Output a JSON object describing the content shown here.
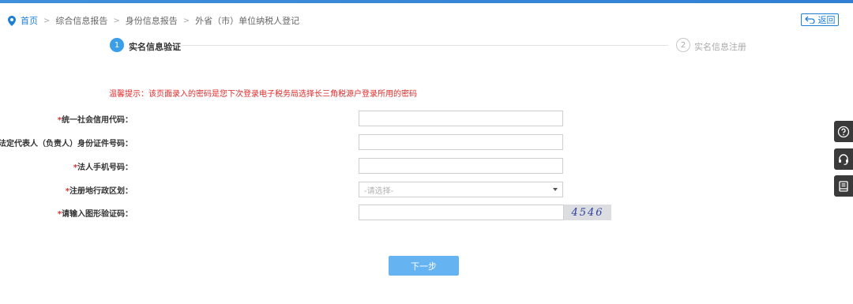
{
  "breadcrumb": {
    "items": [
      "首页",
      "综合信息报告",
      "身份信息报告",
      "外省（市）单位纳税人登记"
    ],
    "separator": ">"
  },
  "back_button": {
    "label": "返回",
    "icon": "back-arrow-icon"
  },
  "steps": [
    {
      "number": "1",
      "label": "实名信息验证",
      "state": "active"
    },
    {
      "number": "2",
      "label": "实名信息注册",
      "state": "inactive"
    }
  ],
  "tip": "温馨提示：该页面录入的密码是您下次登录电子税务局选择长三角税源户登录所用的密码",
  "form": {
    "required_mark": "*",
    "fields": [
      {
        "label": "统一社会信用代码：",
        "value": ""
      },
      {
        "label": "法定代表人（负责人）身份证件号码：",
        "value": ""
      },
      {
        "label": "法人手机号码：",
        "value": ""
      },
      {
        "label": "注册地行政区划：",
        "value": "",
        "selected": "-请选择-"
      },
      {
        "label": "请输入图形验证码：",
        "value": "",
        "captcha_text": "4546"
      }
    ]
  },
  "next_button": {
    "label": "下一步"
  },
  "side_tools": [
    "help-icon",
    "customer-service-icon",
    "manual-icon"
  ],
  "colors": {
    "accent": "#1e7fd6",
    "step_active": "#3a9ee8",
    "warning": "#e02b2b",
    "button": "#66b3f1",
    "side_bar": "#3a3a3a"
  }
}
